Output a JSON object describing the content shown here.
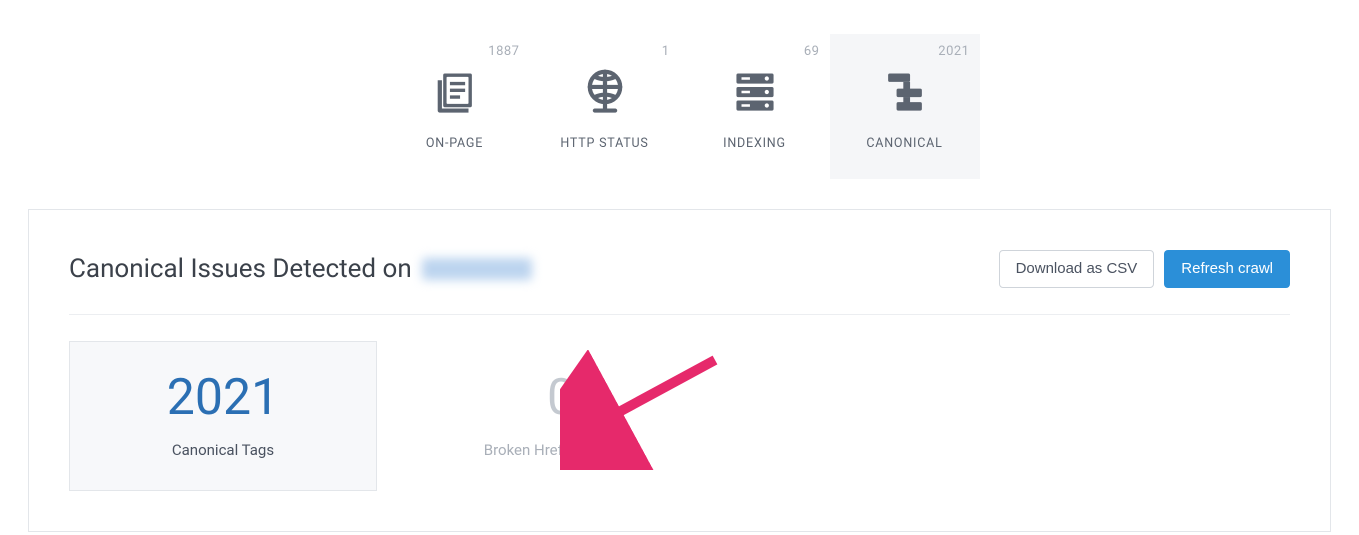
{
  "tabs": [
    {
      "label": "ON-PAGE",
      "count": "1887"
    },
    {
      "label": "HTTP STATUS",
      "count": "1"
    },
    {
      "label": "INDEXING",
      "count": "69"
    },
    {
      "label": "CANONICAL",
      "count": "2021"
    }
  ],
  "panel": {
    "title_prefix": "Canonical Issues Detected on",
    "download_label": "Download as CSV",
    "refresh_label": "Refresh crawl"
  },
  "stats": [
    {
      "value": "2021",
      "label": "Canonical Tags"
    },
    {
      "value": "0",
      "label": "Broken Hreflang Issues"
    }
  ]
}
